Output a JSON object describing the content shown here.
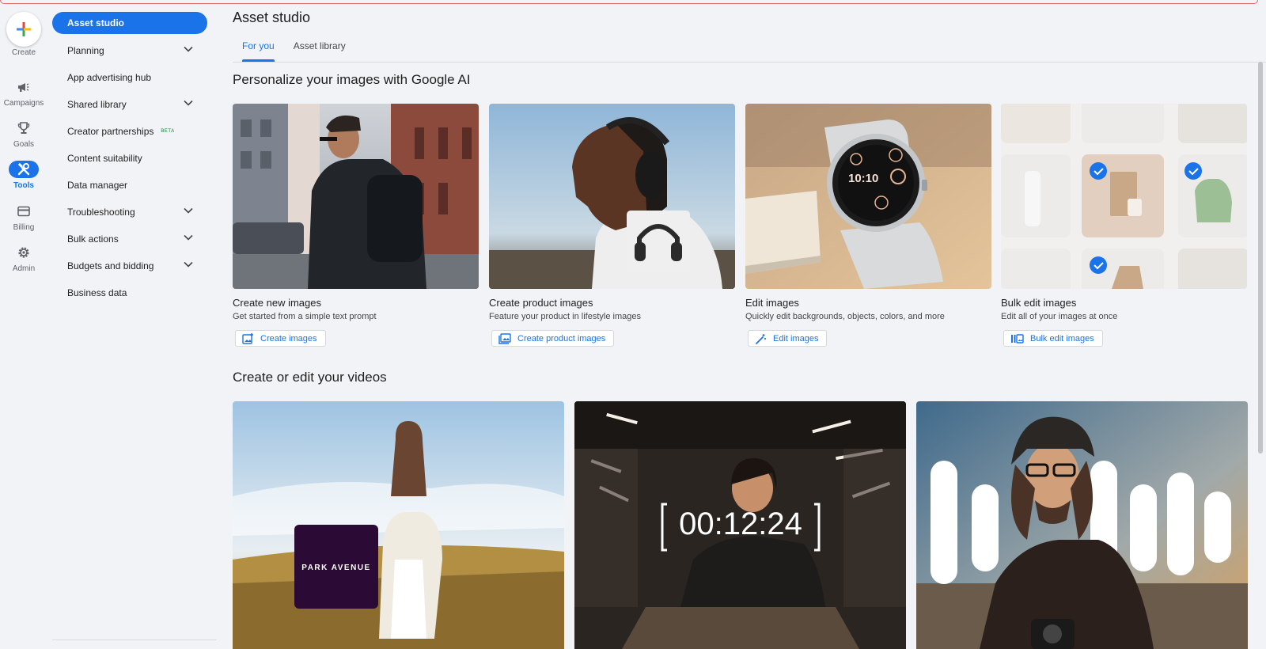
{
  "rail": {
    "create_label": "Create",
    "items": [
      {
        "label": "Campaigns",
        "icon": "megaphone-icon"
      },
      {
        "label": "Goals",
        "icon": "trophy-icon"
      },
      {
        "label": "Tools",
        "icon": "tools-icon",
        "active": true
      },
      {
        "label": "Billing",
        "icon": "credit-card-icon"
      },
      {
        "label": "Admin",
        "icon": "gear-icon"
      }
    ]
  },
  "nav": {
    "items": [
      {
        "label": "Asset studio",
        "active": true
      },
      {
        "label": "Planning",
        "expandable": true
      },
      {
        "label": "App advertising hub"
      },
      {
        "label": "Shared library",
        "expandable": true
      },
      {
        "label": "Creator partnerships",
        "badge": "BETA"
      },
      {
        "label": "Content suitability"
      },
      {
        "label": "Data manager"
      },
      {
        "label": "Troubleshooting",
        "expandable": true
      },
      {
        "label": "Bulk actions",
        "expandable": true
      },
      {
        "label": "Budgets and bidding",
        "expandable": true
      },
      {
        "label": "Business data"
      }
    ]
  },
  "page": {
    "title": "Asset studio",
    "tabs": [
      {
        "label": "For you",
        "active": true
      },
      {
        "label": "Asset library"
      }
    ]
  },
  "images_section": {
    "title": "Personalize your images with Google AI",
    "cards": [
      {
        "title": "Create new images",
        "description": "Get started from a simple text prompt",
        "button": "Create images",
        "icon": "add-image-icon"
      },
      {
        "title": "Create product images",
        "description": "Feature your product in lifestyle images",
        "button": "Create product images",
        "icon": "product-image-icon"
      },
      {
        "title": "Edit images",
        "description": "Quickly edit backgrounds, objects, colors, and more",
        "button": "Edit images",
        "icon": "magic-wand-icon"
      },
      {
        "title": "Bulk edit images",
        "description": "Edit all of your images at once",
        "button": "Bulk edit images",
        "icon": "bulk-images-icon"
      }
    ],
    "watch_time": "10:10"
  },
  "videos_section": {
    "title": "Create or edit your videos",
    "brand_text": "PARK AVENUE",
    "timer_text": "00:12:24"
  },
  "colors": {
    "accent": "#1a73e8",
    "background": "#f1f3f6",
    "beta": "#188038"
  }
}
